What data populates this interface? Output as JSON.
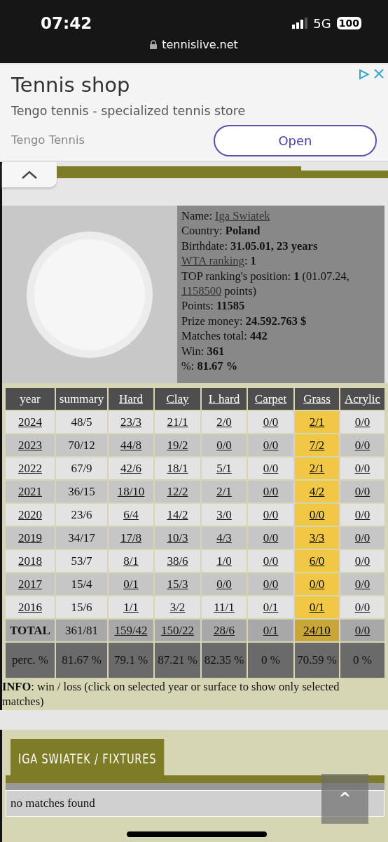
{
  "status_bar": {
    "time": "07:42",
    "network": "5G",
    "battery": "100",
    "url": "tennislive.net"
  },
  "ad": {
    "title": "Tennis shop",
    "description": "Tengo tennis - specialized tennis store",
    "advertiser": "Tengo Tennis",
    "button": "Open"
  },
  "profile": {
    "kind": "picture",
    "lines": [
      [
        {
          "text": "Name: ",
          "kind": "plain"
        },
        {
          "text": "Iga Swiatek",
          "kind": "link"
        }
      ],
      [
        {
          "text": "Country: ",
          "kind": "plain"
        },
        {
          "text": "Poland",
          "kind": "bold"
        }
      ],
      [
        {
          "text": "Birthdate: ",
          "kind": "plain"
        },
        {
          "text": "31.05.01, 23 years",
          "kind": "bold"
        }
      ],
      [
        {
          "text": "WTA ranking",
          "kind": "link"
        },
        {
          "text": ": ",
          "kind": "plain"
        },
        {
          "text": "1",
          "kind": "bold"
        }
      ],
      [
        {
          "text": "TOP ranking's position: ",
          "kind": "plain"
        },
        {
          "text": "1",
          "kind": "bold"
        },
        {
          "text": " (01.07.24, ",
          "kind": "plain"
        },
        {
          "text": "1158500",
          "kind": "link"
        },
        {
          "text": " points)",
          "kind": "plain"
        }
      ],
      [
        {
          "text": "Points: ",
          "kind": "plain"
        },
        {
          "text": "11585",
          "kind": "bold"
        }
      ],
      [
        {
          "text": "Prize money: ",
          "kind": "plain"
        },
        {
          "text": "24.592.763 $",
          "kind": "bold"
        }
      ],
      [
        {
          "text": "Matches total: ",
          "kind": "plain"
        },
        {
          "text": "442",
          "kind": "bold"
        }
      ],
      [
        {
          "text": "Win: ",
          "kind": "plain"
        },
        {
          "text": "361",
          "kind": "bold"
        }
      ],
      [
        {
          "text": "%: ",
          "kind": "plain"
        },
        {
          "text": "81.67 %",
          "kind": "bold"
        }
      ]
    ]
  },
  "table": {
    "columns": [
      {
        "label": "year",
        "link": false,
        "highlighted": false
      },
      {
        "label": "summary",
        "link": false,
        "highlighted": false
      },
      {
        "label": "Hard",
        "link": true,
        "highlighted": false
      },
      {
        "label": "Clay",
        "link": true,
        "highlighted": false
      },
      {
        "label": "I. hard",
        "link": true,
        "highlighted": false
      },
      {
        "label": "Carpet",
        "link": true,
        "highlighted": false
      },
      {
        "label": "Grass",
        "link": true,
        "highlighted": true
      },
      {
        "label": "Acrylic",
        "link": true,
        "highlighted": false
      }
    ],
    "rows": [
      {
        "kind": "year",
        "cells": [
          "2024",
          "48/5",
          "23/3",
          "21/1",
          "2/0",
          "0/0",
          "2/1",
          "0/0"
        ]
      },
      {
        "kind": "year",
        "cells": [
          "2023",
          "70/12",
          "44/8",
          "19/2",
          "0/0",
          "0/0",
          "7/2",
          "0/0"
        ]
      },
      {
        "kind": "year",
        "cells": [
          "2022",
          "67/9",
          "42/6",
          "18/1",
          "5/1",
          "0/0",
          "2/1",
          "0/0"
        ]
      },
      {
        "kind": "year",
        "cells": [
          "2021",
          "36/15",
          "18/10",
          "12/2",
          "2/1",
          "0/0",
          "4/2",
          "0/0"
        ]
      },
      {
        "kind": "year",
        "cells": [
          "2020",
          "23/6",
          "6/4",
          "14/2",
          "3/0",
          "0/0",
          "0/0",
          "0/0"
        ]
      },
      {
        "kind": "year",
        "cells": [
          "2019",
          "34/17",
          "17/8",
          "10/3",
          "4/3",
          "0/0",
          "3/3",
          "0/0"
        ]
      },
      {
        "kind": "year",
        "cells": [
          "2018",
          "53/7",
          "8/1",
          "38/6",
          "1/0",
          "0/0",
          "6/0",
          "0/0"
        ]
      },
      {
        "kind": "year",
        "cells": [
          "2017",
          "15/4",
          "0/1",
          "15/3",
          "0/0",
          "0/0",
          "0/0",
          "0/0"
        ]
      },
      {
        "kind": "year",
        "cells": [
          "2016",
          "15/6",
          "1/1",
          "3/2",
          "11/1",
          "0/1",
          "0/1",
          "0/0"
        ]
      },
      {
        "kind": "total",
        "cells": [
          "TOTAL",
          "361/81",
          "159/42",
          "150/22",
          "28/6",
          "0/1",
          "24/10",
          "0/0"
        ]
      },
      {
        "kind": "percent",
        "cells": [
          "perc. %",
          "81.67 %",
          "79.1 %",
          "87.21 %",
          "82.35 %",
          "0 %",
          "70.59 %",
          "0 %"
        ]
      }
    ]
  },
  "info": "**INFO**: win / loss (click on selected year or surface to show only selected matches)",
  "fixtures": {
    "title": "IGA SWIATEK / FIXTURES",
    "message": "no matches found",
    "top_button": "^"
  }
}
